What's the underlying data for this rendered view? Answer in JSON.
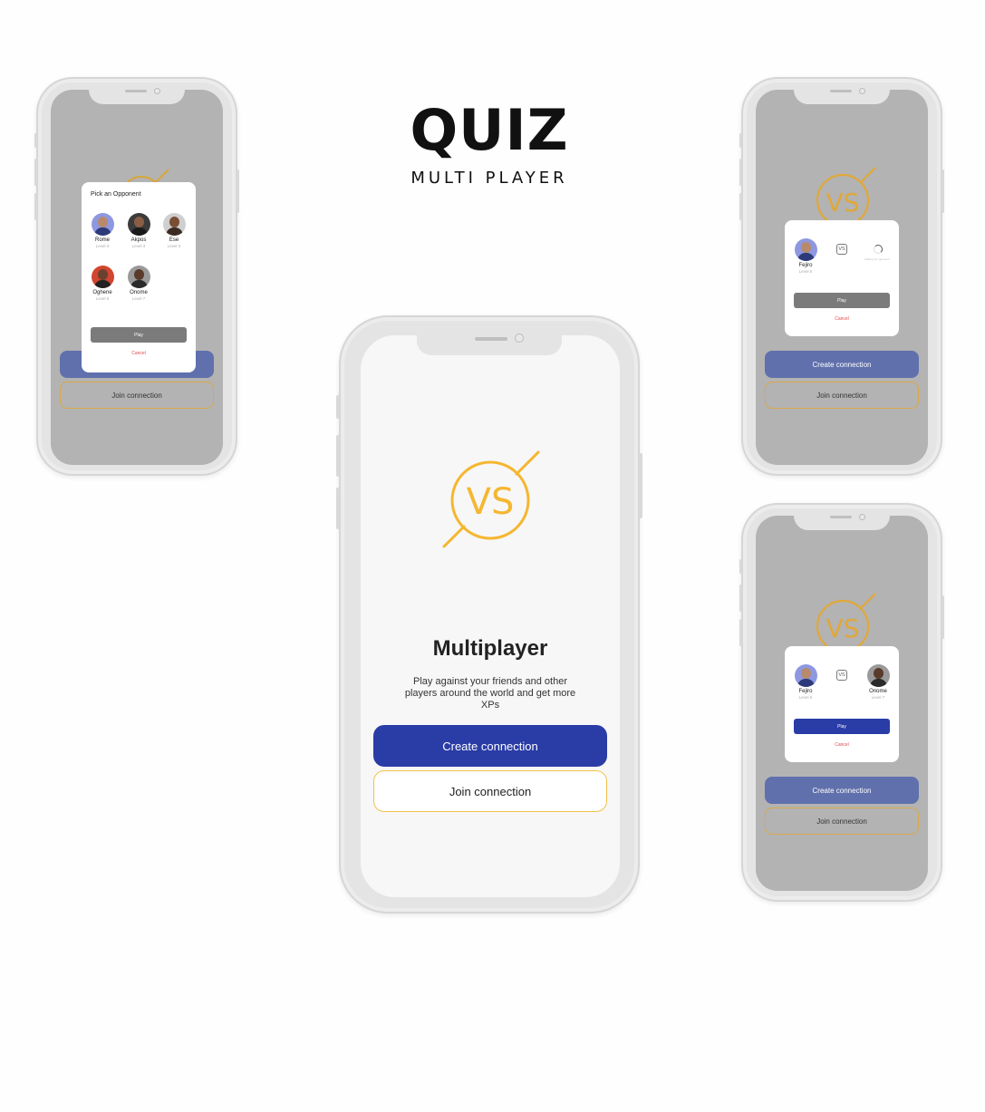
{
  "header": {
    "title": "QUIZ",
    "subtitle": "MULTI PLAYER"
  },
  "colors": {
    "accent_blue": "#2a3ca6",
    "accent_yellow": "#f5b731",
    "cancel_red": "#e04848"
  },
  "main": {
    "logo_text": "VS",
    "heading": "Multiplayer",
    "description": "Play against your friends and other players around the world and get more XPs",
    "create_label": "Create connection",
    "join_label": "Join connection"
  },
  "pick_screen": {
    "modal_title": "Pick an Opponent",
    "opponents": [
      {
        "name": "Rome",
        "level": "Level 3",
        "avatar": "avatar-rome"
      },
      {
        "name": "Akpos",
        "level": "Level 3",
        "avatar": "avatar-akpos"
      },
      {
        "name": "Ese",
        "level": "Level 3",
        "avatar": "avatar-ese"
      },
      {
        "name": "Oghene",
        "level": "Level 5",
        "avatar": "avatar-oghene"
      },
      {
        "name": "Onome",
        "level": "Level 7",
        "avatar": "avatar-onome"
      }
    ],
    "play_label": "Play",
    "cancel_label": "Cancel",
    "join_label": "Join connection"
  },
  "waiting_screen": {
    "player": {
      "name": "Fejiro",
      "level": "Level 5"
    },
    "vs_label": "VS",
    "waiting_text": "Waiting for opponent",
    "play_label": "Play",
    "cancel_label": "Cancel",
    "create_label": "Create connection",
    "join_label": "Join connection"
  },
  "matched_screen": {
    "player": {
      "name": "Fejiro",
      "level": "Level 5"
    },
    "vs_label": "VS",
    "opponent": {
      "name": "Onome",
      "level": "Level 7"
    },
    "play_label": "Play",
    "cancel_label": "Cancel",
    "create_label": "Create connection",
    "join_label": "Join connection"
  }
}
